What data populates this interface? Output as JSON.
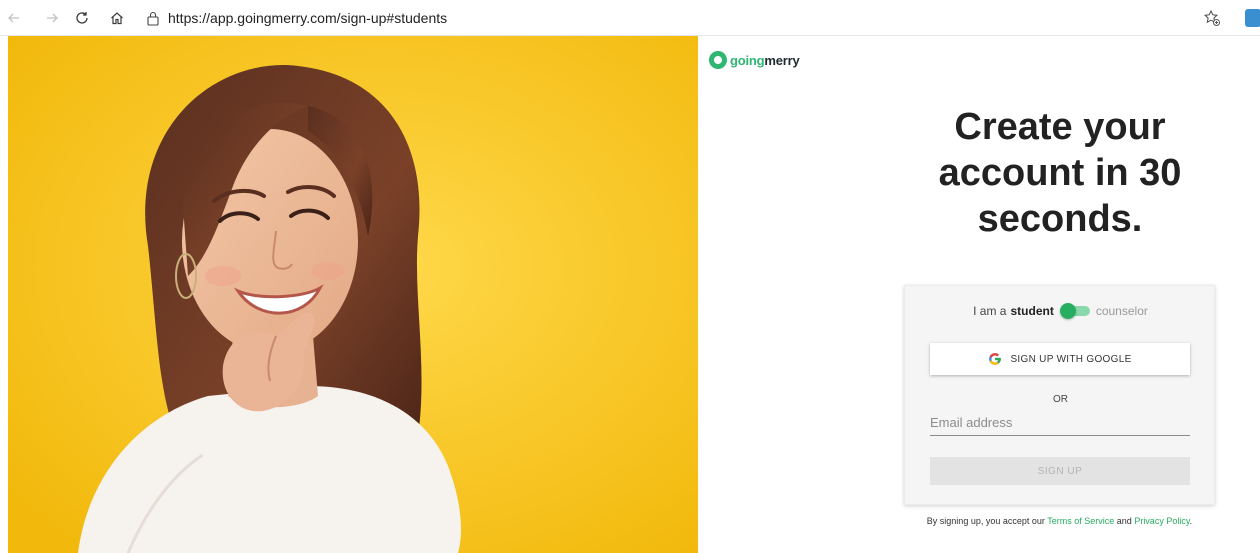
{
  "browser": {
    "url_prefix": "https://",
    "url_host": "app.goingmerry.com",
    "url_path": "/sign-up#students",
    "icons": {
      "back": "arrow-left-icon",
      "forward": "arrow-right-icon",
      "refresh": "refresh-icon",
      "home": "home-icon",
      "lock": "lock-icon",
      "favorite": "favorite-icon",
      "extension": "extension-icon"
    }
  },
  "brand": {
    "name_part1": "going",
    "name_part2": "merry",
    "accent_color": "#2fb673",
    "hero_background": "#f6c318"
  },
  "hero": {
    "description": "smiling-woman-on-yellow-background"
  },
  "signup": {
    "headline": "Create your account in 30 seconds.",
    "role_prefix": "I am a",
    "role_student": "student",
    "role_counselor": "counselor",
    "google_label": "SIGN UP WITH GOOGLE",
    "or_label": "OR",
    "email_placeholder": "Email address",
    "email_value": "",
    "submit_label": "SIGN UP"
  },
  "terms": {
    "prefix": "By signing up, you accept our",
    "tos_label": "Terms of Service",
    "and": "and",
    "privacy_label": "Privacy Policy",
    "suffix": "."
  }
}
